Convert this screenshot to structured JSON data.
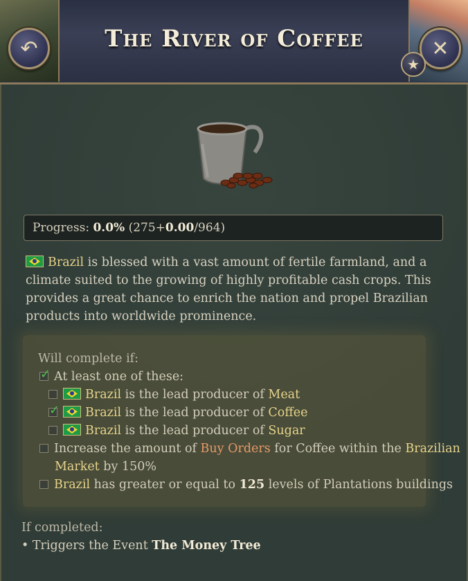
{
  "header": {
    "title": "The River of Coffee",
    "back_icon": "↶",
    "close_icon": "✕",
    "star_icon": "★"
  },
  "progress": {
    "label": "Progress:",
    "percent": "0.0%",
    "open": "(275+",
    "added": "0.00",
    "total": "/964)"
  },
  "description": {
    "country": "Brazil",
    "text": " is blessed with a vast amount of fertile farmland, and a climate suited to the growing of highly profitable cash crops. This provides a great chance to enrich the nation and propel Brazilian products into worldwide prominence."
  },
  "conditions": {
    "header": "Will complete if:",
    "group_label": "At least one of these:",
    "items": [
      {
        "country": "Brazil",
        "text": " is the lead producer of ",
        "good": "Meat",
        "checked": false
      },
      {
        "country": "Brazil",
        "text": " is the lead producer of ",
        "good": "Coffee",
        "checked": true
      },
      {
        "country": "Brazil",
        "text": " is the lead producer of ",
        "good": "Sugar",
        "checked": false
      }
    ],
    "buy_orders": {
      "pre": "Increase the amount of ",
      "link": "Buy Orders",
      "mid": " for Coffee within the ",
      "market_a": "Brazilian",
      "market_b": "Market",
      "post": " by 150%"
    },
    "plantations": {
      "country": "Brazil",
      "pre": " has greater or equal to ",
      "count": "125",
      "post": " levels of Plantations buildings"
    }
  },
  "completion": {
    "header": "If completed:",
    "bullet": "• Triggers the Event ",
    "event": "The Money Tree"
  }
}
